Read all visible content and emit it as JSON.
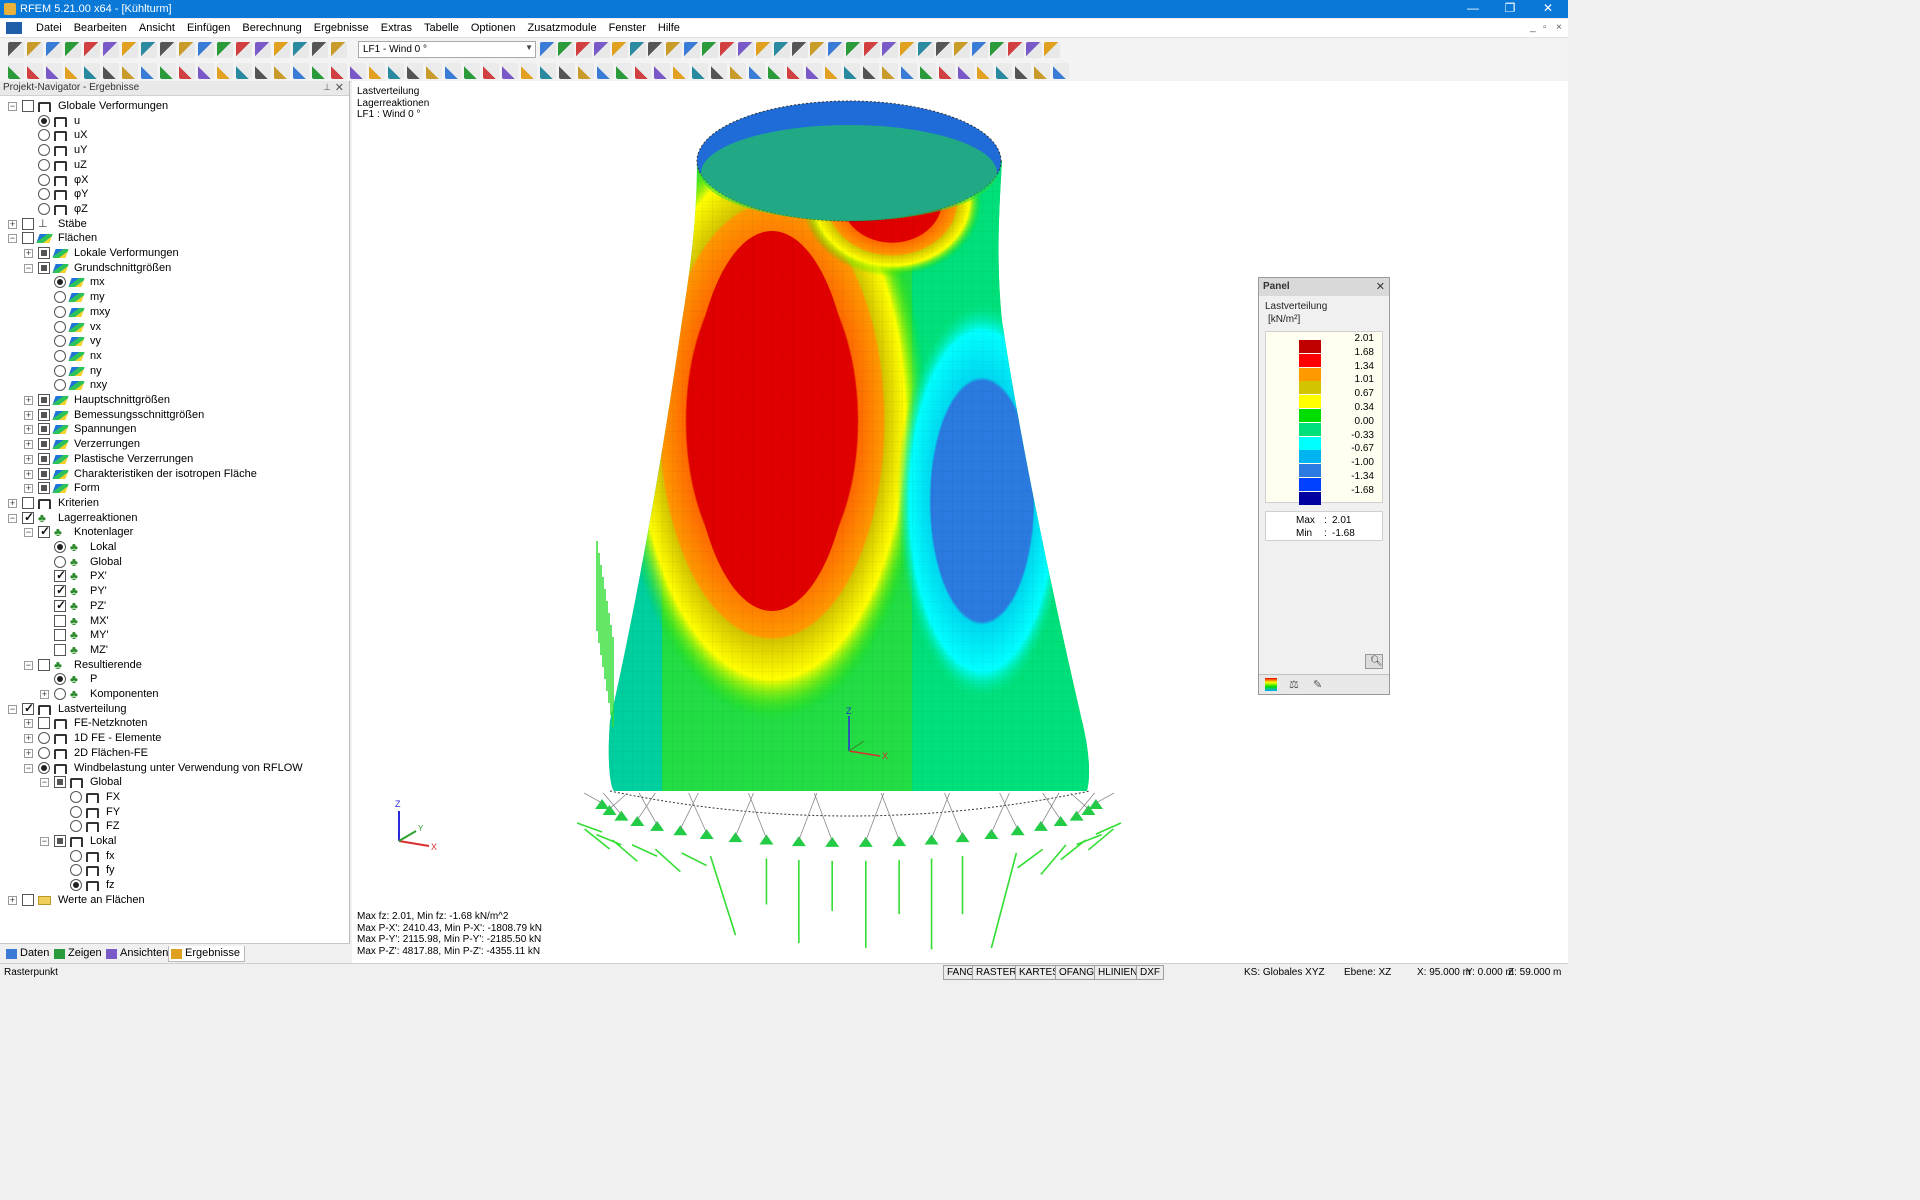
{
  "window": {
    "title": "RFEM 5.21.00 x64 - [Kühlturm]",
    "minimize": "—",
    "maximize": "❐",
    "close": "✕"
  },
  "menu": {
    "items": [
      "Datei",
      "Bearbeiten",
      "Ansicht",
      "Einfügen",
      "Berechnung",
      "Ergebnisse",
      "Extras",
      "Tabelle",
      "Optionen",
      "Zusatzmodule",
      "Fenster",
      "Hilfe"
    ],
    "mdi_minimize": "_",
    "mdi_restore": "▫",
    "mdi_close": "×"
  },
  "toolbar": {
    "loadcase_value": "LF1 - Wind 0 °"
  },
  "navigator": {
    "title": "Projekt-Navigator - Ergebnisse",
    "pin": "⊥",
    "close": "✕",
    "tree": [
      {
        "label": "Globale Verformungen",
        "indent": 0,
        "exp": "-",
        "ctl": "check",
        "sel": false,
        "icon": "bracket"
      },
      {
        "label": "u",
        "indent": 1,
        "ctl": "radio",
        "sel": true,
        "icon": "bracket"
      },
      {
        "label": "uX",
        "indent": 1,
        "ctl": "radio",
        "sel": false,
        "icon": "bracket"
      },
      {
        "label": "uY",
        "indent": 1,
        "ctl": "radio",
        "sel": false,
        "icon": "bracket"
      },
      {
        "label": "uZ",
        "indent": 1,
        "ctl": "radio",
        "sel": false,
        "icon": "bracket"
      },
      {
        "label": "φX",
        "indent": 1,
        "ctl": "radio",
        "sel": false,
        "icon": "bracket"
      },
      {
        "label": "φY",
        "indent": 1,
        "ctl": "radio",
        "sel": false,
        "icon": "bracket"
      },
      {
        "label": "φZ",
        "indent": 1,
        "ctl": "radio",
        "sel": false,
        "icon": "bracket"
      },
      {
        "label": "Stäbe",
        "indent": 0,
        "exp": "+",
        "ctl": "check",
        "sel": false,
        "icon": "member"
      },
      {
        "label": "Flächen",
        "indent": 0,
        "exp": "-",
        "ctl": "check",
        "sel": false,
        "icon": "surface"
      },
      {
        "label": "Lokale Verformungen",
        "indent": 1,
        "exp": "+",
        "ctl": "check",
        "partial": true,
        "icon": "surface"
      },
      {
        "label": "Grundschnittgrößen",
        "indent": 1,
        "exp": "-",
        "ctl": "check",
        "partial": true,
        "icon": "surface"
      },
      {
        "label": "mx",
        "indent": 2,
        "ctl": "radio",
        "sel": true,
        "icon": "surface"
      },
      {
        "label": "my",
        "indent": 2,
        "ctl": "radio",
        "sel": false,
        "icon": "surface"
      },
      {
        "label": "mxy",
        "indent": 2,
        "ctl": "radio",
        "sel": false,
        "icon": "surface"
      },
      {
        "label": "vx",
        "indent": 2,
        "ctl": "radio",
        "sel": false,
        "icon": "surface"
      },
      {
        "label": "vy",
        "indent": 2,
        "ctl": "radio",
        "sel": false,
        "icon": "surface"
      },
      {
        "label": "nx",
        "indent": 2,
        "ctl": "radio",
        "sel": false,
        "icon": "surface"
      },
      {
        "label": "ny",
        "indent": 2,
        "ctl": "radio",
        "sel": false,
        "icon": "surface"
      },
      {
        "label": "nxy",
        "indent": 2,
        "ctl": "radio",
        "sel": false,
        "icon": "surface"
      },
      {
        "label": "Hauptschnittgrößen",
        "indent": 1,
        "exp": "+",
        "ctl": "check",
        "partial": true,
        "icon": "surface"
      },
      {
        "label": "Bemessungsschnittgrößen",
        "indent": 1,
        "exp": "+",
        "ctl": "check",
        "partial": true,
        "icon": "surface"
      },
      {
        "label": "Spannungen",
        "indent": 1,
        "exp": "+",
        "ctl": "check",
        "partial": true,
        "icon": "surface"
      },
      {
        "label": "Verzerrungen",
        "indent": 1,
        "exp": "+",
        "ctl": "check",
        "partial": true,
        "icon": "surface"
      },
      {
        "label": "Plastische Verzerrungen",
        "indent": 1,
        "exp": "+",
        "ctl": "check",
        "partial": true,
        "icon": "surface"
      },
      {
        "label": "Charakteristiken der isotropen Fläche",
        "indent": 1,
        "exp": "+",
        "ctl": "check",
        "partial": true,
        "icon": "surface"
      },
      {
        "label": "Form",
        "indent": 1,
        "exp": "+",
        "ctl": "check",
        "partial": true,
        "icon": "surface"
      },
      {
        "label": "Kriterien",
        "indent": 0,
        "exp": "+",
        "ctl": "check",
        "sel": false,
        "icon": "bracket"
      },
      {
        "label": "Lagerreaktionen",
        "indent": 0,
        "exp": "-",
        "ctl": "check",
        "sel": true,
        "icon": "support"
      },
      {
        "label": "Knotenlager",
        "indent": 1,
        "exp": "-",
        "ctl": "check",
        "sel": true,
        "icon": "support"
      },
      {
        "label": "Lokal",
        "indent": 2,
        "ctl": "radio",
        "sel": true,
        "icon": "support"
      },
      {
        "label": "Global",
        "indent": 2,
        "ctl": "radio",
        "sel": false,
        "icon": "support"
      },
      {
        "label": "PX'",
        "indent": 2,
        "ctl": "check",
        "sel": true,
        "icon": "support"
      },
      {
        "label": "PY'",
        "indent": 2,
        "ctl": "check",
        "sel": true,
        "icon": "support"
      },
      {
        "label": "PZ'",
        "indent": 2,
        "ctl": "check",
        "sel": true,
        "icon": "support"
      },
      {
        "label": "MX'",
        "indent": 2,
        "ctl": "check",
        "sel": false,
        "icon": "support"
      },
      {
        "label": "MY'",
        "indent": 2,
        "ctl": "check",
        "sel": false,
        "icon": "support"
      },
      {
        "label": "MZ'",
        "indent": 2,
        "ctl": "check",
        "sel": false,
        "icon": "support"
      },
      {
        "label": "Resultierende",
        "indent": 1,
        "exp": "-",
        "ctl": "check",
        "sel": false,
        "icon": "support"
      },
      {
        "label": "P",
        "indent": 2,
        "ctl": "radio",
        "sel": true,
        "icon": "support"
      },
      {
        "label": "Komponenten",
        "indent": 2,
        "exp": "+",
        "ctl": "radio",
        "sel": false,
        "icon": "support"
      },
      {
        "label": "Lastverteilung",
        "indent": 0,
        "exp": "-",
        "ctl": "check",
        "sel": true,
        "icon": "bracket"
      },
      {
        "label": "FE-Netzknoten",
        "indent": 1,
        "exp": "+",
        "ctl": "check",
        "sel": false,
        "icon": "bracket"
      },
      {
        "label": "1D FE - Elemente",
        "indent": 1,
        "exp": "+",
        "ctl": "radio",
        "sel": false,
        "icon": "bracket"
      },
      {
        "label": "2D Flächen-FE",
        "indent": 1,
        "exp": "+",
        "ctl": "radio",
        "sel": false,
        "icon": "bracket"
      },
      {
        "label": "Windbelastung unter Verwendung von RFLOW",
        "indent": 1,
        "exp": "-",
        "ctl": "radio",
        "sel": true,
        "icon": "bracket"
      },
      {
        "label": "Global",
        "indent": 2,
        "exp": "-",
        "ctl": "check",
        "partial": true,
        "icon": "bracket"
      },
      {
        "label": "FX",
        "indent": 3,
        "ctl": "radio",
        "sel": false,
        "icon": "bracket"
      },
      {
        "label": "FY",
        "indent": 3,
        "ctl": "radio",
        "sel": false,
        "icon": "bracket"
      },
      {
        "label": "FZ",
        "indent": 3,
        "ctl": "radio",
        "sel": false,
        "icon": "bracket"
      },
      {
        "label": "Lokal",
        "indent": 2,
        "exp": "-",
        "ctl": "check",
        "partial": true,
        "icon": "bracket"
      },
      {
        "label": "fx",
        "indent": 3,
        "ctl": "radio",
        "sel": false,
        "icon": "bracket"
      },
      {
        "label": "fy",
        "indent": 3,
        "ctl": "radio",
        "sel": false,
        "icon": "bracket"
      },
      {
        "label": "fz",
        "indent": 3,
        "ctl": "radio",
        "sel": true,
        "icon": "bracket"
      },
      {
        "label": "Werte an Flächen",
        "indent": 0,
        "exp": "+",
        "ctl": "check",
        "sel": false,
        "icon": "folder"
      }
    ],
    "tabs": [
      "Daten",
      "Zeigen",
      "Ansichten",
      "Ergebnisse"
    ],
    "active_tab": "Ergebnisse"
  },
  "viewport": {
    "info_lines": [
      "Lastverteilung",
      "Lagerreaktionen",
      "LF1 : Wind 0 °"
    ],
    "summary_lines": [
      "Max fz: 2.01, Min fz: -1.68 kN/m^2",
      "Max P-X': 2410.43, Min P-X': -1808.79 kN",
      "Max P-Y': 2115.98, Min P-Y': -2185.50 kN",
      "Max P-Z': 4817.88, Min P-Z': -4355.11 kN"
    ],
    "axis_labels": {
      "x": "X",
      "y": "Y",
      "z": "Z"
    }
  },
  "panel": {
    "title": "Panel",
    "close": "✕",
    "result": "Lastverteilung",
    "unit": "[kN/m²]",
    "scale": [
      {
        "value": "2.01",
        "color": "#c00000"
      },
      {
        "value": "1.68",
        "color": "#ff0000"
      },
      {
        "value": "1.34",
        "color": "#ff9900"
      },
      {
        "value": "1.01",
        "color": "#d4c400"
      },
      {
        "value": "0.67",
        "color": "#ffff00"
      },
      {
        "value": "0.34",
        "color": "#00dd00"
      },
      {
        "value": "0.00",
        "color": "#00e07a"
      },
      {
        "value": "-0.33",
        "color": "#00ffff"
      },
      {
        "value": "-0.67",
        "color": "#00b4f0"
      },
      {
        "value": "-1.00",
        "color": "#2a7ae0"
      },
      {
        "value": "-1.34",
        "color": "#0040ff"
      },
      {
        "value": "-1.68",
        "color": "#0000a0"
      }
    ],
    "max_label": "Max",
    "max_value": "2.01",
    "min_label": "Min",
    "min_value": "-1.68"
  },
  "statusbar": {
    "left": "Rasterpunkt",
    "buttons": [
      "FANG",
      "RASTER",
      "KARTES",
      "OFANG",
      "HLINIEN",
      "DXF"
    ],
    "ks": "KS: Globales XYZ",
    "ebene": "Ebene: XZ",
    "x": "X:  95.000 m",
    "y": "Y:  0.000 m",
    "z": "Z:  59.000 m"
  }
}
